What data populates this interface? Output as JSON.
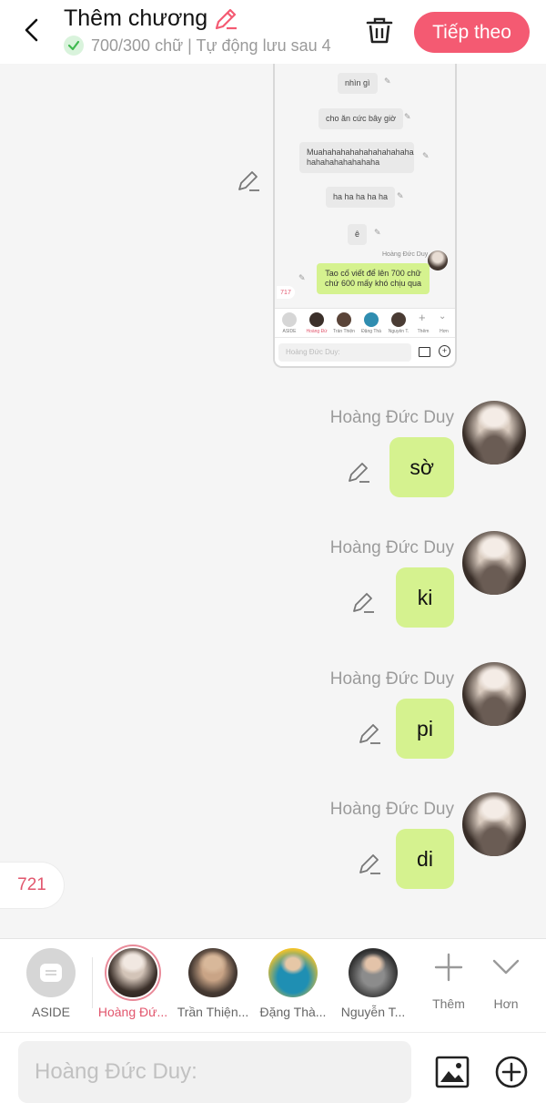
{
  "header": {
    "title": "Thêm chương",
    "status": "700/300 chữ | Tự động lưu sau 4",
    "next_label": "Tiếp theo"
  },
  "embedded": {
    "messages": [
      "nhìn gì",
      "cho ăn cức bây giờ",
      "Muahahahahahahahahahaha hahahahahahahaha",
      "ha ha ha ha ha",
      "ê"
    ],
    "sender": "Hoàng Đức Duy",
    "green_message": "Tao cố viết để lên 700 chữ chứ 600 mấy khó chịu qua",
    "count": "717",
    "chars": [
      "ASIDE",
      "Hoàng Đứ",
      "Trần Thiện",
      "Đặng Thà",
      "Nguyễn T.",
      "Thêm",
      "Hơn"
    ],
    "placeholder": "Hoàng Đức Duy:"
  },
  "messages": [
    {
      "sender": "Hoàng Đức Duy",
      "text": "sờ"
    },
    {
      "sender": "Hoàng Đức Duy",
      "text": "ki"
    },
    {
      "sender": "Hoàng Đức Duy",
      "text": "pi"
    },
    {
      "sender": "Hoàng Đức Duy",
      "text": "di"
    }
  ],
  "word_count": "721",
  "characters": [
    {
      "label": "ASIDE"
    },
    {
      "label": "Hoàng Đứ..."
    },
    {
      "label": "Trần Thiện..."
    },
    {
      "label": "Đặng Thà..."
    },
    {
      "label": "Nguyễn T..."
    }
  ],
  "tools": {
    "add_label": "Thêm",
    "more_label": "Hơn"
  },
  "input": {
    "placeholder": "Hoàng Đức Duy:"
  },
  "colors": {
    "accent": "#f45a72",
    "bubble_green": "#d5f28f",
    "count_red": "#e2566d"
  }
}
